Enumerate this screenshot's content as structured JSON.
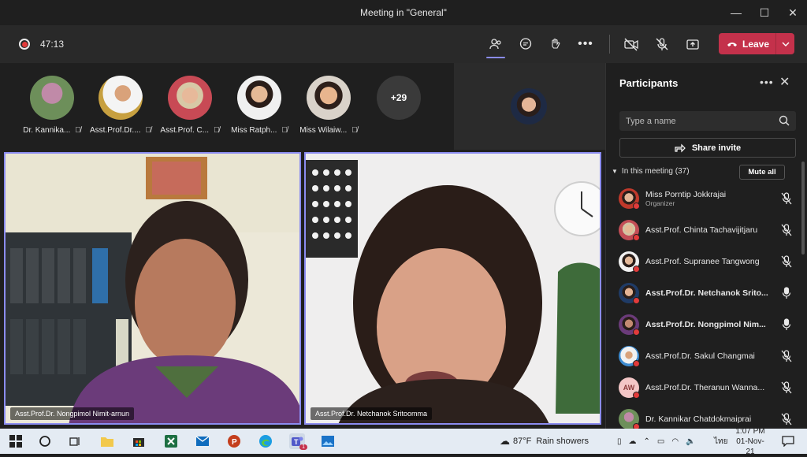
{
  "window": {
    "title": "Meeting in \"General\""
  },
  "toolbar": {
    "timer": "47:13",
    "leave_label": "Leave"
  },
  "strip": {
    "participants": [
      {
        "name": "Dr. Kannika..."
      },
      {
        "name": "Asst.Prof.Dr...."
      },
      {
        "name": "Asst.Prof. C..."
      },
      {
        "name": "Miss Ratph..."
      },
      {
        "name": "Miss Wilaiw..."
      }
    ],
    "overflow": "+29"
  },
  "tiles": [
    {
      "label": "Asst.Prof.Dr. Nongpimol Nimit-arnun"
    },
    {
      "label": "Asst.Prof.Dr. Netchanok Sritoomma"
    }
  ],
  "panel": {
    "title": "Participants",
    "search_placeholder": "Type a name",
    "share_label": "Share invite",
    "section_label": "In this meeting (37)",
    "mute_all_label": "Mute all",
    "rows": [
      {
        "name": "Miss Porntip Jokkrajai",
        "sub": "Organizer",
        "bold": false,
        "mic": "muted"
      },
      {
        "name": "Asst.Prof. Chinta Tachavijitjaru",
        "sub": "",
        "bold": false,
        "mic": "muted"
      },
      {
        "name": "Asst.Prof. Supranee Tangwong",
        "sub": "",
        "bold": false,
        "mic": "muted"
      },
      {
        "name": "Asst.Prof.Dr. Netchanok Srito...",
        "sub": "",
        "bold": true,
        "mic": "on"
      },
      {
        "name": "Asst.Prof.Dr. Nongpimol Nim...",
        "sub": "",
        "bold": true,
        "mic": "on"
      },
      {
        "name": "Asst.Prof.Dr. Sakul Changmai",
        "sub": "",
        "bold": false,
        "mic": "muted"
      },
      {
        "name": "Asst.Prof.Dr. Theranun Wanna...",
        "sub": "",
        "bold": false,
        "mic": "muted",
        "initials": "AW"
      },
      {
        "name": "Dr. Kannikar Chatdokmaiprai",
        "sub": "",
        "bold": false,
        "mic": "muted"
      }
    ]
  },
  "taskbar": {
    "weather_temp": "87°F",
    "weather_text": "Rain showers",
    "lang": "ไทย",
    "time": "1:07 PM",
    "date": "01-Nov-21",
    "teams_badge": "1"
  },
  "colors": {
    "accent": "#8b8cf0",
    "leave": "#c4314b",
    "muted_dot": "#e23b3b"
  }
}
